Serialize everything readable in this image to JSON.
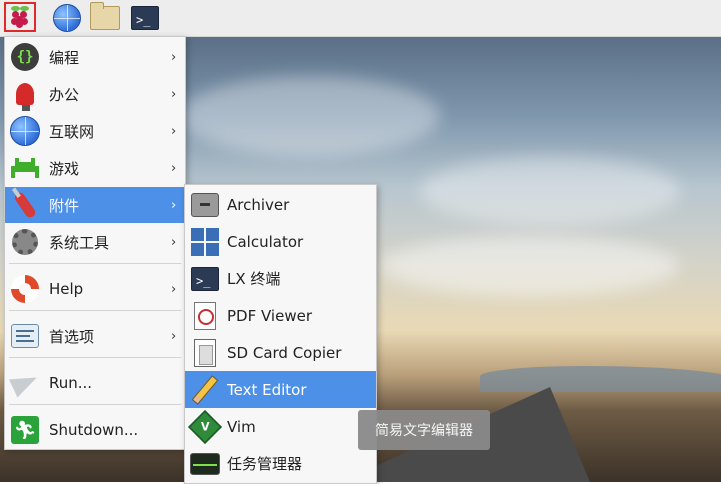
{
  "panel": {
    "icons": [
      "raspberry-menu-icon",
      "web-browser-icon",
      "file-manager-icon",
      "terminal-icon"
    ],
    "terminal_glyph": ">_"
  },
  "menu": {
    "items": [
      {
        "label": "编程",
        "icon": "programming-icon",
        "has_submenu": true
      },
      {
        "label": "办公",
        "icon": "office-icon",
        "has_submenu": true
      },
      {
        "label": "互联网",
        "icon": "internet-icon",
        "has_submenu": true
      },
      {
        "label": "游戏",
        "icon": "games-icon",
        "has_submenu": true
      },
      {
        "label": "附件",
        "icon": "accessories-icon",
        "has_submenu": true,
        "active": true
      },
      {
        "label": "系统工具",
        "icon": "system-tools-icon",
        "has_submenu": true
      },
      {
        "label": "Help",
        "icon": "help-icon",
        "has_submenu": true
      },
      {
        "label": "首选项",
        "icon": "preferences-icon",
        "has_submenu": true
      },
      {
        "label": "Run...",
        "icon": "run-icon",
        "has_submenu": false
      },
      {
        "label": "Shutdown...",
        "icon": "shutdown-icon",
        "has_submenu": false
      }
    ],
    "arrow": "›"
  },
  "submenu": {
    "items": [
      {
        "label": "Archiver",
        "icon": "archiver-icon"
      },
      {
        "label": "Calculator",
        "icon": "calculator-icon"
      },
      {
        "label": "LX 终端",
        "icon": "terminal-icon"
      },
      {
        "label": "PDF Viewer",
        "icon": "pdf-viewer-icon"
      },
      {
        "label": "SD Card Copier",
        "icon": "sd-card-icon"
      },
      {
        "label": "Text Editor",
        "icon": "pencil-icon",
        "active": true
      },
      {
        "label": "Vim",
        "icon": "vim-icon"
      },
      {
        "label": "任务管理器",
        "icon": "task-manager-icon"
      }
    ]
  },
  "tooltip": {
    "text": "简易文字编辑器"
  },
  "colors": {
    "accent": "#4d90e8",
    "menu_bg": "#f7f7f7",
    "panel_bg": "#ededed"
  }
}
